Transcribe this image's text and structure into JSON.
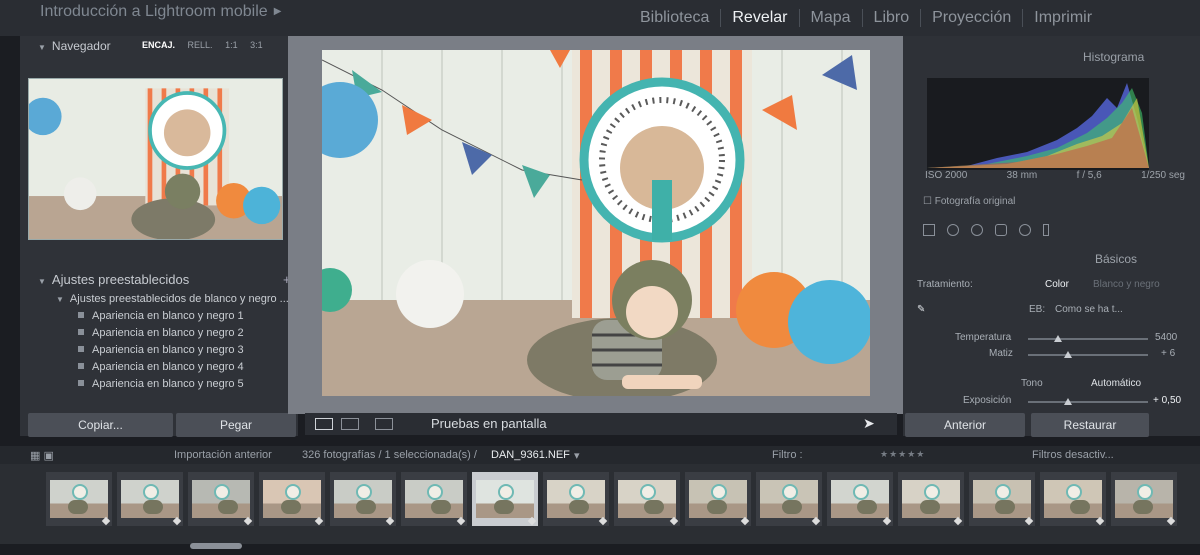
{
  "window": {
    "title": "Introducción a Lightroom mobile"
  },
  "modules": [
    "Biblioteca",
    "Revelar",
    "Mapa",
    "Libro",
    "Proyección",
    "Imprimir"
  ],
  "active_module": "Revelar",
  "navigator": {
    "title": "Navegador",
    "zoom_options": [
      "ENCAJ.",
      "RELL.",
      "1:1",
      "3:1"
    ],
    "zoom_selected": "ENCAJ."
  },
  "presets": {
    "title": "Ajustes preestablecidos",
    "add": "+",
    "folder": "Ajustes preestablecidos de blanco y negro ...",
    "items": [
      "Apariencia en blanco y negro 1",
      "Apariencia en blanco y negro 2",
      "Apariencia en blanco y negro 3",
      "Apariencia en blanco y negro 4",
      "Apariencia en blanco y negro 5"
    ]
  },
  "left_buttons": {
    "copy": "Copiar...",
    "paste": "Pegar"
  },
  "toolbar": {
    "soft_proof": "Pruebas en pantalla"
  },
  "histogram": {
    "title": "Histograma",
    "iso": "ISO 2000",
    "focal": "38 mm",
    "aperture": "f / 5,6",
    "shutter": "1/250 seg",
    "original": "Fotografía original"
  },
  "basic": {
    "title": "Básicos",
    "treatment_label": "Tratamiento:",
    "treatment_color": "Color",
    "treatment_bw": "Blanco y negro",
    "wb_label": "EB:",
    "wb_value": "Como se ha t...",
    "temp_label": "Temperatura",
    "temp_value": "5400",
    "tint_label": "Matiz",
    "tint_value": "+ 6",
    "tone_label": "Tono",
    "auto_label": "Automático",
    "exposure_label": "Exposición",
    "exposure_value": "+ 0,50"
  },
  "right_buttons": {
    "previous": "Anterior",
    "reset": "Restaurar"
  },
  "filmstrip_bar": {
    "source": "Importación anterior",
    "count": "326 fotografías / 1 seleccionada(s) /",
    "filename": "DAN_9361.NEF",
    "filter_label": "Filtro :",
    "filter_state": "Filtros desactiv..."
  },
  "filmstrip": {
    "thumb_count": 16,
    "selected_index": 6
  }
}
